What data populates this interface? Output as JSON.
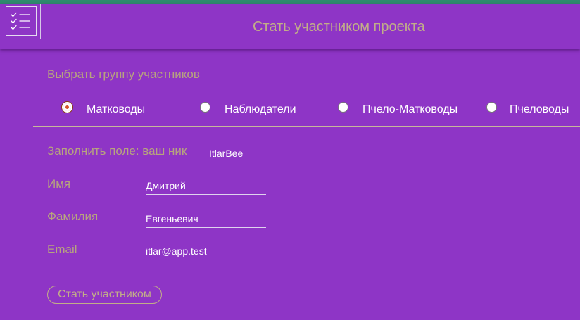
{
  "header": {
    "title": "Стать участником проекта",
    "menu_icon": "checklist-icon"
  },
  "group": {
    "label": "Выбрать группу участников",
    "options": [
      {
        "label": "Матководы",
        "checked": true
      },
      {
        "label": "Наблюдатели",
        "checked": false
      },
      {
        "label": "Пчело-Матководы",
        "checked": false
      },
      {
        "label": "Пчеловоды",
        "checked": false
      }
    ]
  },
  "form": {
    "nick": {
      "label": "Заполнить поле: ваш ник",
      "value": "ItlarBee"
    },
    "first_name": {
      "label": "Имя",
      "value": "Дмитрий"
    },
    "last_name": {
      "label": "Фамилия",
      "value": "Евгеньевич"
    },
    "email": {
      "label": "Email",
      "value": "itlar@app.test"
    }
  },
  "submit_label": "Стать участником",
  "colors": {
    "background": "#8e35c6",
    "accent_top": "#2e8b6e",
    "label_text": "#b8a47e",
    "radio_checked": "#d8552a"
  }
}
